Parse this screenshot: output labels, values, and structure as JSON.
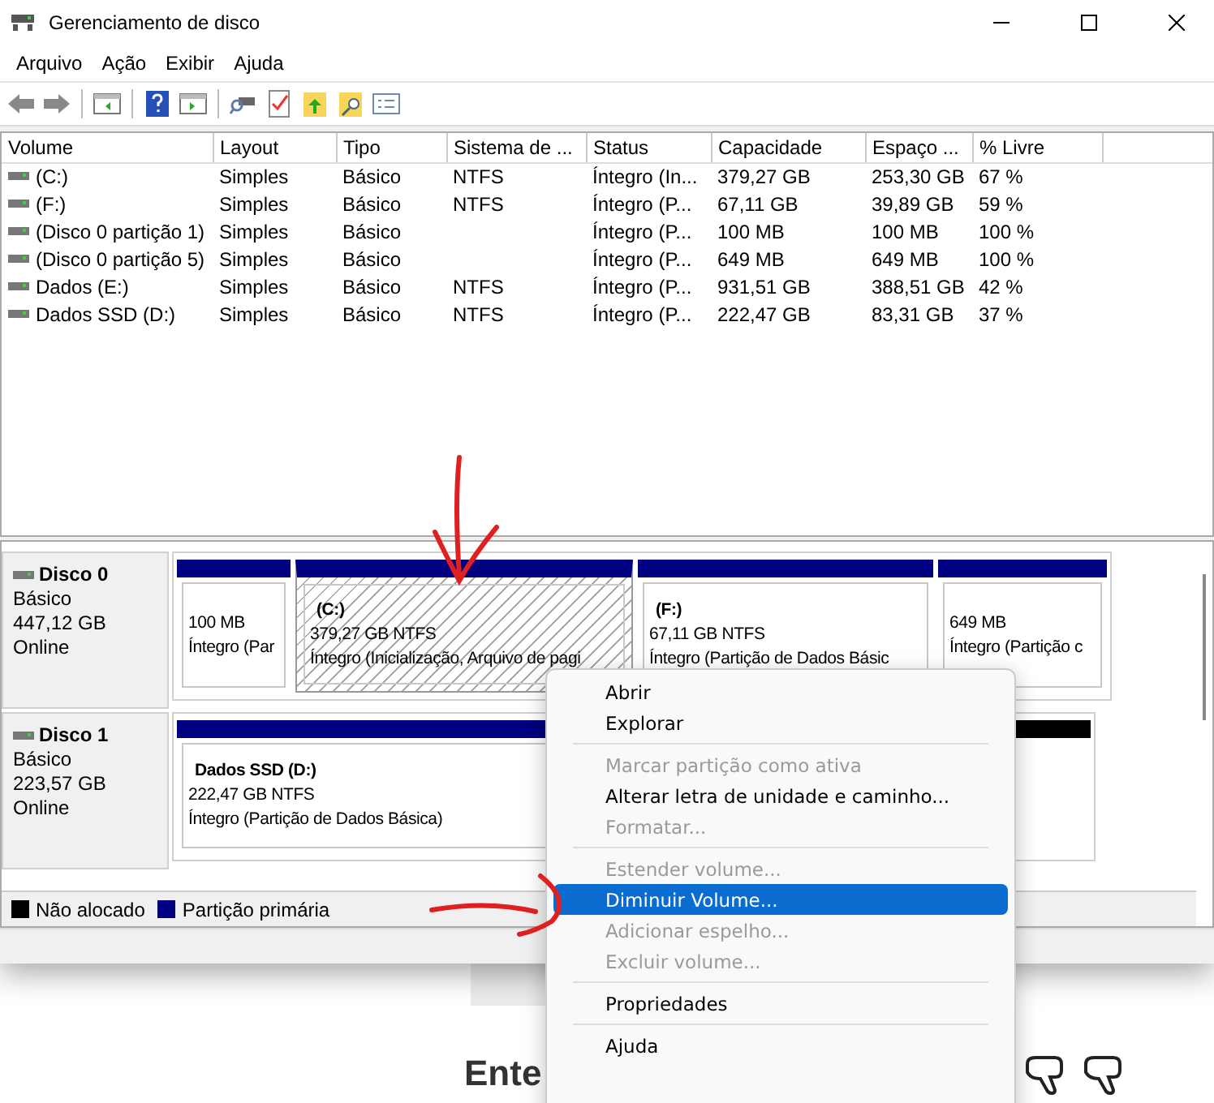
{
  "window": {
    "title": "Gerenciamento de disco"
  },
  "menu": [
    "Arquivo",
    "Ação",
    "Exibir",
    "Ajuda"
  ],
  "volume_table": {
    "columns": [
      "Volume",
      "Layout",
      "Tipo",
      "Sistema de ...",
      "Status",
      "Capacidade",
      "Espaço ...",
      "% Livre"
    ],
    "rows": [
      [
        "(C:)",
        "Simples",
        "Básico",
        "NTFS",
        "Íntegro (In...",
        "379,27 GB",
        "253,30 GB",
        "67 %"
      ],
      [
        "(F:)",
        "Simples",
        "Básico",
        "NTFS",
        "Íntegro (P...",
        "67,11 GB",
        "39,89 GB",
        "59 %"
      ],
      [
        "(Disco 0 partição 1)",
        "Simples",
        "Básico",
        "",
        "Íntegro (P...",
        "100 MB",
        "100 MB",
        "100 %"
      ],
      [
        "(Disco 0 partição 5)",
        "Simples",
        "Básico",
        "",
        "Íntegro (P...",
        "649 MB",
        "649 MB",
        "100 %"
      ],
      [
        "Dados (E:)",
        "Simples",
        "Básico",
        "NTFS",
        "Íntegro (P...",
        "931,51 GB",
        "388,51 GB",
        "42 %"
      ],
      [
        "Dados SSD (D:)",
        "Simples",
        "Básico",
        "NTFS",
        "Íntegro (P...",
        "222,47 GB",
        "83,31 GB",
        "37 %"
      ]
    ]
  },
  "disks": [
    {
      "name": "Disco 0",
      "type": "Básico",
      "size": "447,12 GB",
      "status": "Online",
      "partitions": [
        {
          "kind": "primary",
          "selected": false,
          "size": "100 MB",
          "status": "Íntegro (Par"
        },
        {
          "kind": "primary",
          "selected": true,
          "label": "(C:)",
          "size": "379,27 GB NTFS",
          "status": "Íntegro (Inicialização, Arquivo de pagi"
        },
        {
          "kind": "primary",
          "selected": false,
          "label": "(F:)",
          "size": "67,11 GB NTFS",
          "status": "Íntegro (Partição de Dados Básic"
        },
        {
          "kind": "primary",
          "selected": false,
          "size": "649 MB",
          "status": "Íntegro (Partição c"
        }
      ]
    },
    {
      "name": "Disco 1",
      "type": "Básico",
      "size": "223,57 GB",
      "status": "Online",
      "partitions": [
        {
          "kind": "primary",
          "selected": false,
          "label": "Dados SSD  (D:)",
          "size": "222,47 GB NTFS",
          "status": "Íntegro (Partição de Dados Básica)"
        },
        {
          "kind": "unallocated",
          "selected": false
        }
      ]
    }
  ],
  "legend": [
    {
      "label": "Não alocado",
      "color": "#000000"
    },
    {
      "label": "Partição primária",
      "color": "#000080"
    }
  ],
  "context_menu": [
    [
      {
        "label": "Abrir",
        "disabled": false,
        "selected": false
      },
      {
        "label": "Explorar",
        "disabled": false,
        "selected": false
      }
    ],
    [
      {
        "label": "Marcar partição como ativa",
        "disabled": true,
        "selected": false
      },
      {
        "label": "Alterar letra de unidade e caminho...",
        "disabled": false,
        "selected": false
      },
      {
        "label": "Formatar...",
        "disabled": true,
        "selected": false
      }
    ],
    [
      {
        "label": "Estender volume...",
        "disabled": true,
        "selected": false
      },
      {
        "label": "Diminuir Volume...",
        "disabled": false,
        "selected": true
      },
      {
        "label": "Adicionar espelho...",
        "disabled": true,
        "selected": false
      },
      {
        "label": "Excluir volume...",
        "disabled": true,
        "selected": false
      }
    ],
    [
      {
        "label": "Propriedades",
        "disabled": false,
        "selected": false
      }
    ],
    [
      {
        "label": "Ajuda",
        "disabled": false,
        "selected": false
      }
    ]
  ],
  "page_behind": {
    "heading": "Ente"
  }
}
